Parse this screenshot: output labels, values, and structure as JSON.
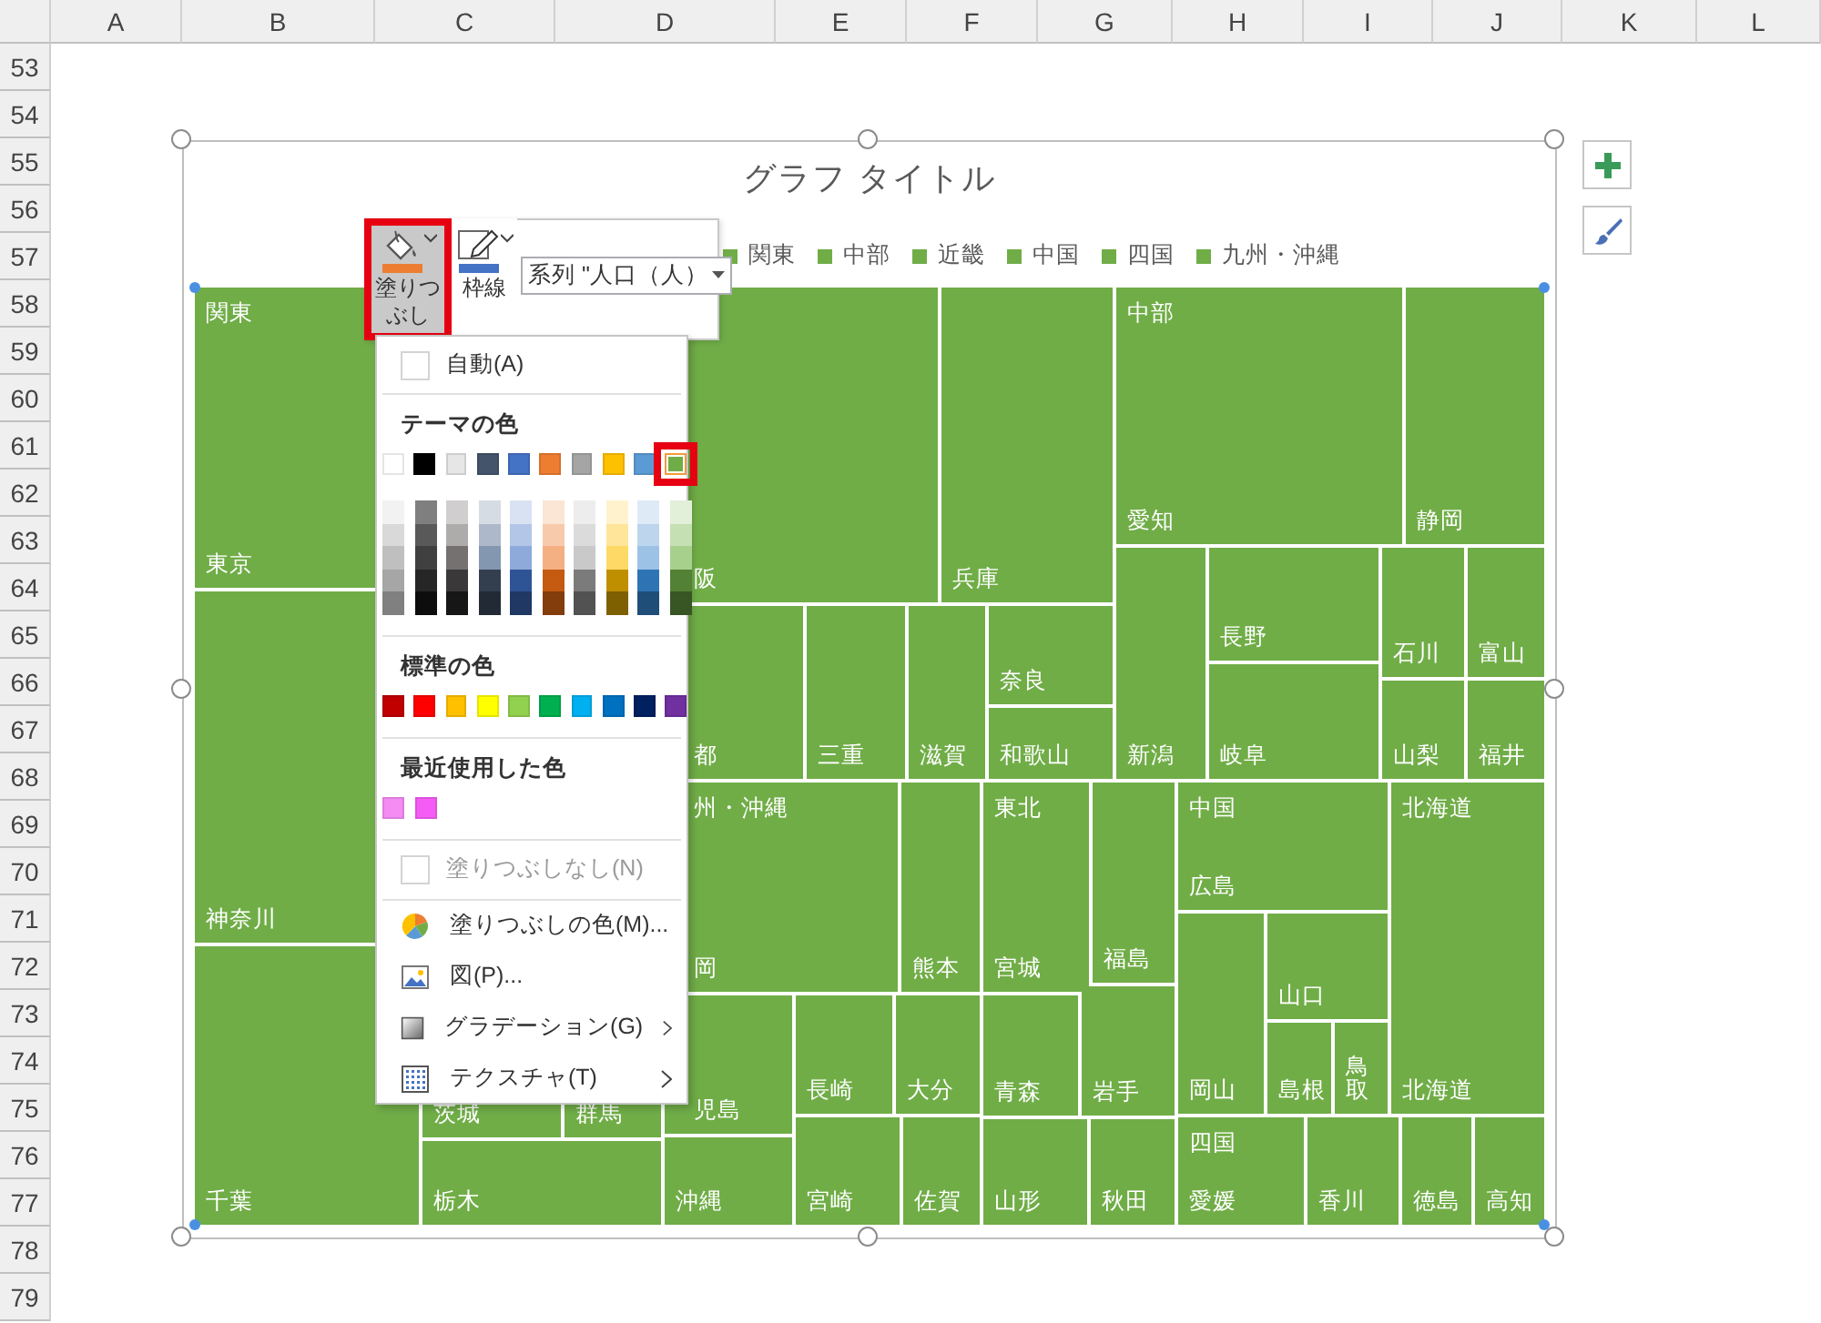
{
  "sheet": {
    "columns": [
      "A",
      "B",
      "C",
      "D",
      "E",
      "F",
      "G",
      "H",
      "I",
      "J",
      "K",
      "L"
    ],
    "rows": [
      "53",
      "54",
      "55",
      "56",
      "57",
      "58",
      "59",
      "60",
      "61",
      "62",
      "63",
      "64",
      "65",
      "66",
      "67",
      "68",
      "69",
      "70",
      "71",
      "72",
      "73",
      "74",
      "75",
      "76",
      "77",
      "78",
      "79"
    ]
  },
  "chart": {
    "title": "グラフ タイトル",
    "legend": [
      {
        "label": "関東"
      },
      {
        "label": "中部"
      },
      {
        "label": "近畿"
      },
      {
        "label": "中国"
      },
      {
        "label": "四国"
      },
      {
        "label": "九州・沖縄"
      }
    ],
    "regions": [
      {
        "header": "関東",
        "tiles": [
          {
            "label": "東京"
          },
          {
            "label": "神奈川"
          },
          {
            "label": "千葉"
          },
          {
            "label": "茨城"
          },
          {
            "label": "群馬"
          },
          {
            "label": "栃木"
          }
        ]
      },
      {
        "tiles": [
          {
            "label": "阪"
          },
          {
            "label": "兵庫"
          },
          {
            "label": "都"
          },
          {
            "label": "三重"
          },
          {
            "label": "滋賀"
          },
          {
            "label": "奈良"
          },
          {
            "label": "和歌山"
          }
        ]
      },
      {
        "header": "中部",
        "tiles": [
          {
            "label": "愛知"
          },
          {
            "label": "静岡"
          },
          {
            "label": "新潟"
          },
          {
            "label": "長野"
          },
          {
            "label": "岐阜"
          },
          {
            "label": "石川"
          },
          {
            "label": "富山"
          },
          {
            "label": "山梨"
          },
          {
            "label": "福井"
          }
        ]
      },
      {
        "header": "州・沖縄",
        "tiles": [
          {
            "label": "岡"
          },
          {
            "label": "熊本"
          },
          {
            "label": "児島"
          },
          {
            "label": "長崎"
          },
          {
            "label": "大分"
          },
          {
            "label": "沖縄"
          },
          {
            "label": "宮崎"
          },
          {
            "label": "佐賀"
          }
        ]
      },
      {
        "header": "東北",
        "tiles": [
          {
            "label": "宮城"
          },
          {
            "label": "福島"
          },
          {
            "label": "青森"
          },
          {
            "label": "岩手"
          },
          {
            "label": "山形"
          },
          {
            "label": "秋田"
          }
        ]
      },
      {
        "header": "中国",
        "tiles": [
          {
            "label": "広島"
          },
          {
            "label": "岡山"
          },
          {
            "label": "山口"
          },
          {
            "label": "島根"
          },
          {
            "label": "鳥取"
          }
        ]
      },
      {
        "header": "北海道",
        "tiles": [
          {
            "label": "北海道"
          }
        ]
      },
      {
        "header": "四国",
        "tiles": [
          {
            "label": "愛媛"
          },
          {
            "label": "香川"
          },
          {
            "label": "徳島"
          },
          {
            "label": "高知"
          }
        ]
      }
    ]
  },
  "toolbar": {
    "buttons": [
      {
        "label": "塗りつぶし",
        "highlighted": true
      },
      {
        "label": "枠線",
        "highlighted": false
      }
    ],
    "series": "系列 \"人口（人）"
  },
  "fill_menu": [
    {
      "kind": "check",
      "label": "自動(A)",
      "disabled": false
    },
    {
      "kind": "palette",
      "title": "テーマの色",
      "swatches": [
        {
          "color": "#ffffff",
          "selected": false,
          "shades": [
            {
              "color": "#f2f2f2"
            },
            {
              "color": "#d9d9d9"
            },
            {
              "color": "#bfbfbf"
            },
            {
              "color": "#a6a6a6"
            },
            {
              "color": "#808080"
            }
          ]
        },
        {
          "color": "#000000",
          "selected": false,
          "shades": [
            {
              "color": "#7f7f7f"
            },
            {
              "color": "#595959"
            },
            {
              "color": "#404040"
            },
            {
              "color": "#262626"
            },
            {
              "color": "#0d0d0d"
            }
          ]
        },
        {
          "color": "#e7e6e6",
          "selected": false,
          "shades": [
            {
              "color": "#d0cece"
            },
            {
              "color": "#aeabab"
            },
            {
              "color": "#757171"
            },
            {
              "color": "#3a3838"
            },
            {
              "color": "#171616"
            }
          ]
        },
        {
          "color": "#44546a",
          "selected": false,
          "shades": [
            {
              "color": "#d6dce4"
            },
            {
              "color": "#adb9ca"
            },
            {
              "color": "#8497b0"
            },
            {
              "color": "#333f4f"
            },
            {
              "color": "#222a35"
            }
          ]
        },
        {
          "color": "#4472c4",
          "selected": false,
          "shades": [
            {
              "color": "#d9e2f3"
            },
            {
              "color": "#b4c6e7"
            },
            {
              "color": "#8eaadb"
            },
            {
              "color": "#2f5496"
            },
            {
              "color": "#1f3864"
            }
          ]
        },
        {
          "color": "#ed7d31",
          "selected": false,
          "shades": [
            {
              "color": "#fbe5d5"
            },
            {
              "color": "#f7caac"
            },
            {
              "color": "#f4b083"
            },
            {
              "color": "#c55a11"
            },
            {
              "color": "#833c0b"
            }
          ]
        },
        {
          "color": "#a5a5a5",
          "selected": false,
          "shades": [
            {
              "color": "#ededed"
            },
            {
              "color": "#dbdbdb"
            },
            {
              "color": "#c9c9c9"
            },
            {
              "color": "#7b7b7b"
            },
            {
              "color": "#525252"
            }
          ]
        },
        {
          "color": "#ffc000",
          "selected": false,
          "shades": [
            {
              "color": "#fff2cc"
            },
            {
              "color": "#fee599"
            },
            {
              "color": "#ffd965"
            },
            {
              "color": "#bf8f00"
            },
            {
              "color": "#7f6000"
            }
          ]
        },
        {
          "color": "#5b9bd5",
          "selected": false,
          "shades": [
            {
              "color": "#deeaf6"
            },
            {
              "color": "#bdd6ee"
            },
            {
              "color": "#9cc2e5"
            },
            {
              "color": "#2e74b5"
            },
            {
              "color": "#1f4e79"
            }
          ]
        },
        {
          "color": "#70ad47",
          "selected": true,
          "shades": [
            {
              "color": "#e2efd9"
            },
            {
              "color": "#c5e0b3"
            },
            {
              "color": "#a8d08d"
            },
            {
              "color": "#538135"
            },
            {
              "color": "#375623"
            }
          ]
        }
      ]
    },
    {
      "kind": "palette",
      "title": "標準の色",
      "swatches": [
        {
          "color": "#c00000",
          "selected": false
        },
        {
          "color": "#ff0000",
          "selected": false
        },
        {
          "color": "#ffc000",
          "selected": false
        },
        {
          "color": "#ffff00",
          "selected": false
        },
        {
          "color": "#92d050",
          "selected": false
        },
        {
          "color": "#00b050",
          "selected": false
        },
        {
          "color": "#00b0f0",
          "selected": false
        },
        {
          "color": "#0070c0",
          "selected": false
        },
        {
          "color": "#002060",
          "selected": false
        },
        {
          "color": "#7030a0",
          "selected": false
        }
      ]
    },
    {
      "kind": "palette",
      "title": "最近使用した色",
      "swatches": [
        {
          "color": "#f48cf4",
          "selected": false
        },
        {
          "color": "#f55cf5",
          "selected": false
        }
      ]
    },
    {
      "kind": "check",
      "label": "塗りつぶしなし(N)",
      "disabled": true
    },
    {
      "kind": "command",
      "label": "塗りつぶしの色(M)...",
      "submenu": false
    },
    {
      "kind": "command",
      "label": "図(P)...",
      "submenu": false
    },
    {
      "kind": "command",
      "label": "グラデーション(G)",
      "submenu": true
    },
    {
      "kind": "command",
      "label": "テクスチャ(T)",
      "submenu": true
    }
  ]
}
